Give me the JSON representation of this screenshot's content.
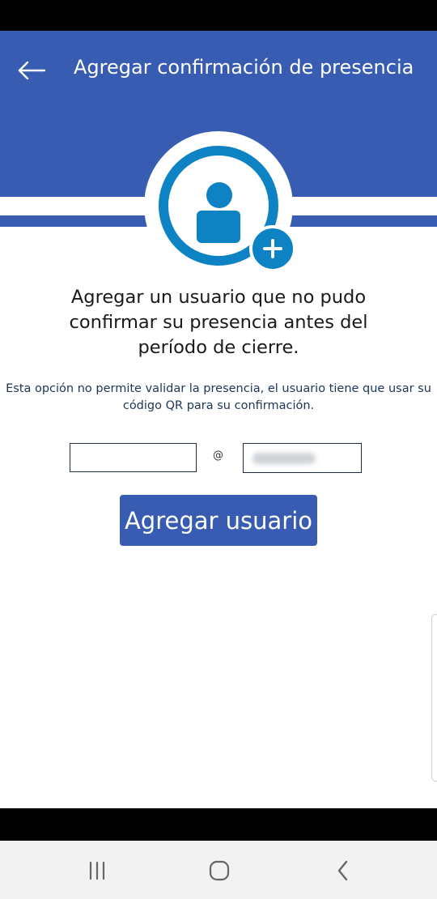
{
  "colors": {
    "brand": "#385cb1",
    "accent": "#0e83c4"
  },
  "header": {
    "title": "Agregar confirmación de presencia",
    "back_icon": "arrow-left-icon"
  },
  "avatar": {
    "icon": "user-add-icon"
  },
  "content": {
    "heading": "Agregar un usuario que no pudo confirmar su presencia antes del período de cierre.",
    "note": "Esta opción no permite validar la presencia, el usuario tiene que usar su código QR para su confirmación."
  },
  "form": {
    "username_value": "",
    "at_sign": "@",
    "submit_label": "Agregar usuario"
  },
  "navbar": {
    "recent_icon": "recent-apps-icon",
    "home_icon": "home-icon",
    "back_icon": "back-chevron-icon"
  }
}
